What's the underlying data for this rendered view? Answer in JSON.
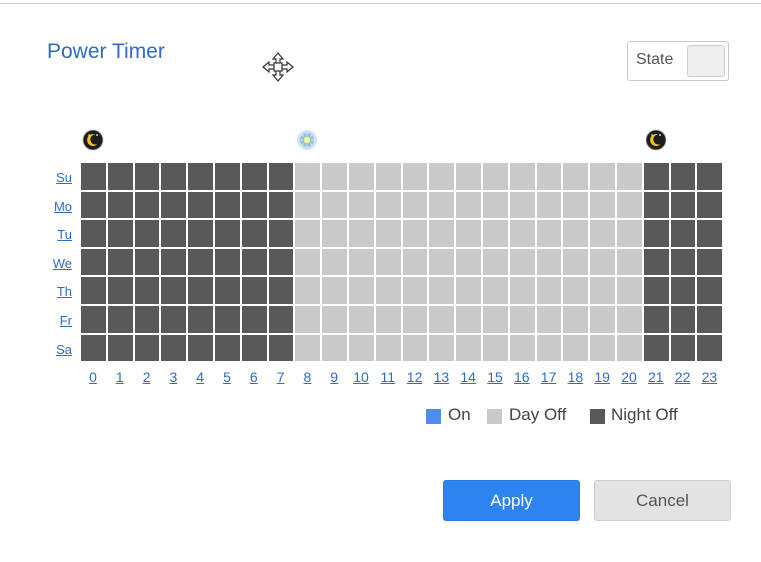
{
  "title": "Power Timer",
  "state": {
    "label": "State",
    "on": false
  },
  "days": [
    "Su",
    "Mo",
    "Tu",
    "We",
    "Th",
    "Fr",
    "Sa"
  ],
  "hours": [
    "0",
    "1",
    "2",
    "3",
    "4",
    "5",
    "6",
    "7",
    "8",
    "9",
    "10",
    "11",
    "12",
    "13",
    "14",
    "15",
    "16",
    "17",
    "18",
    "19",
    "20",
    "21",
    "22",
    "23"
  ],
  "markers": [
    {
      "name": "night-start-moon-icon",
      "hour": 0,
      "kind": "moon"
    },
    {
      "name": "day-start-sun-icon",
      "hour": 8,
      "kind": "sun"
    },
    {
      "name": "night-end-moon-icon",
      "hour": 21,
      "kind": "moon"
    }
  ],
  "schedule": {
    "night_hours": [
      0,
      1,
      2,
      3,
      4,
      5,
      6,
      7,
      21,
      22,
      23
    ],
    "day_hours": [
      8,
      9,
      10,
      11,
      12,
      13,
      14,
      15,
      16,
      17,
      18,
      19,
      20
    ],
    "on_hours": []
  },
  "legend": {
    "on": "On",
    "day_off": "Day Off",
    "night_off": "Night Off"
  },
  "colors": {
    "on": "#4f8ee8",
    "day_off": "#c9c9c9",
    "night_off": "#595959",
    "accent": "#2f6bc7",
    "apply": "#2d84f0"
  },
  "buttons": {
    "apply": "Apply",
    "cancel": "Cancel"
  }
}
